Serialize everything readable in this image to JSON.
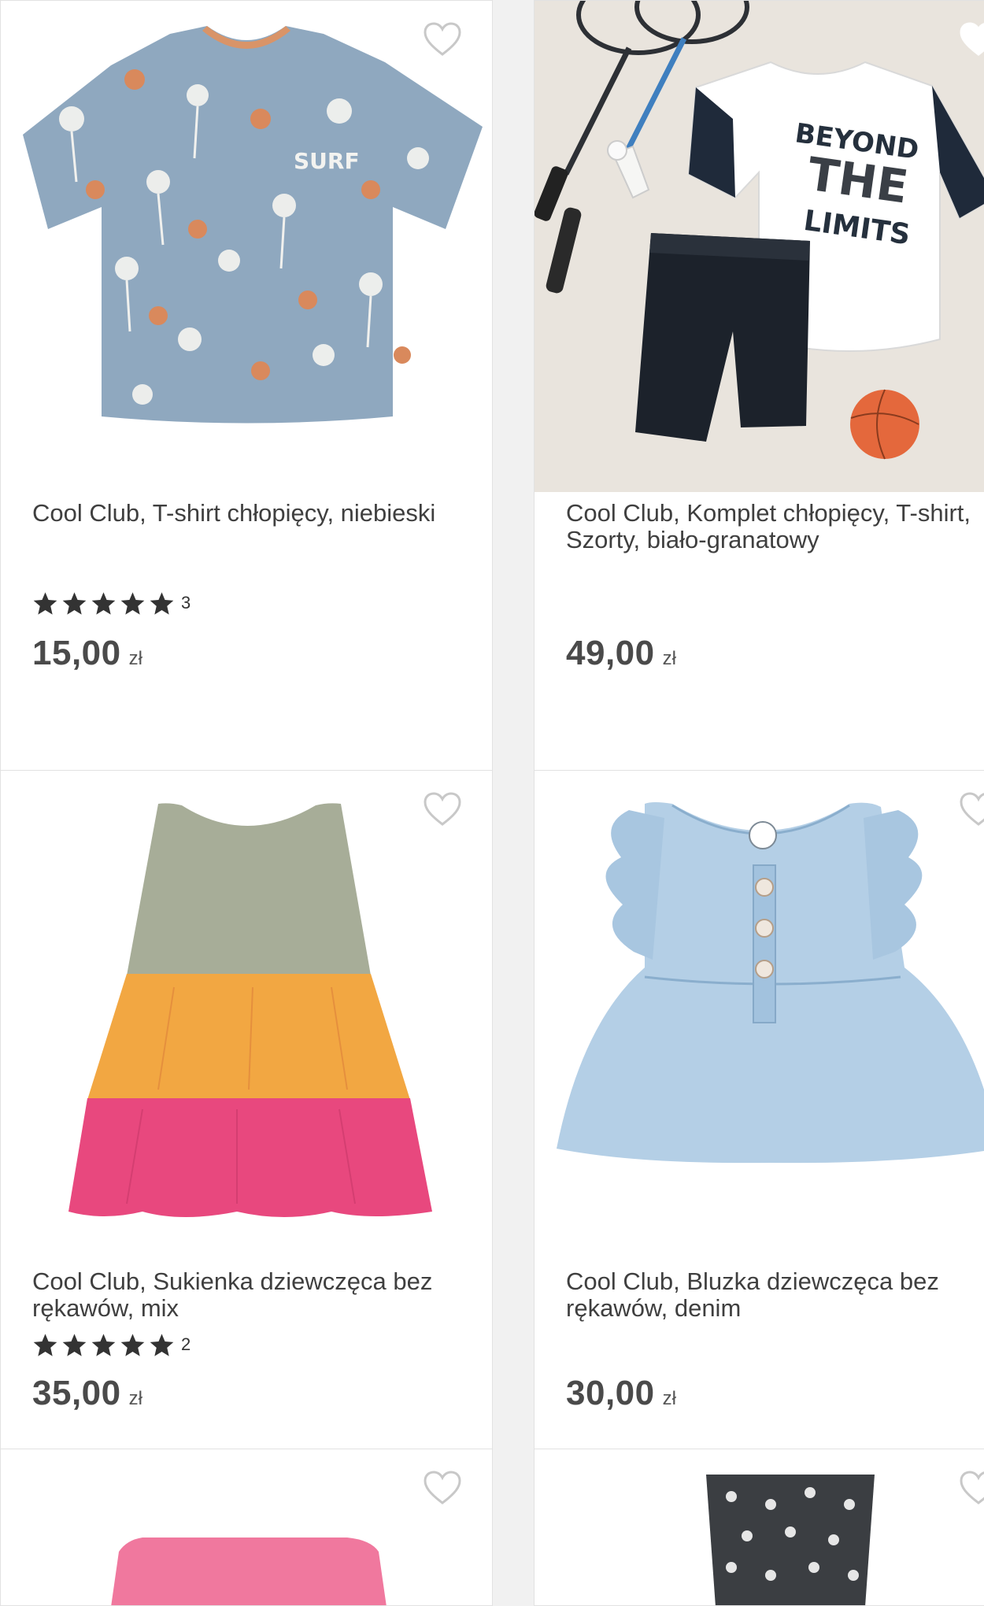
{
  "products": [
    {
      "title": "Cool Club, T-shirt chłopięcy, niebieski",
      "rating_count": "3",
      "stars": 5,
      "price": "15,00",
      "currency": "zł",
      "image": "tshirt-palms",
      "print_text": "SURF"
    },
    {
      "title": "Cool Club, Komplet chłopięcy, T-shirt, Szorty, biało-granatowy",
      "rating_count": "",
      "stars": 0,
      "price": "49,00",
      "currency": "zł",
      "image": "set-tshirt-shorts",
      "print_text": "BEYOND THE LIMITS"
    },
    {
      "title": "Cool Club, Sukienka dziewczęca bez rękawów, mix",
      "rating_count": "2",
      "stars": 5,
      "price": "35,00",
      "currency": "zł",
      "image": "dress-tiered"
    },
    {
      "title": "Cool Club, Bluzka dziewczęca bez rękawów, denim",
      "rating_count": "",
      "stars": 0,
      "price": "30,00",
      "currency": "zł",
      "image": "denim-blouse"
    },
    {
      "image": "pink-shorts"
    },
    {
      "image": "dotted-shorts"
    }
  ],
  "icons": {
    "favorite": "heart-outline-icon",
    "rating": "star-filled-icon"
  },
  "colors": {
    "background": "#f1f1f1",
    "card": "#ffffff",
    "price": "#4a4a4a",
    "star": "#333333"
  }
}
